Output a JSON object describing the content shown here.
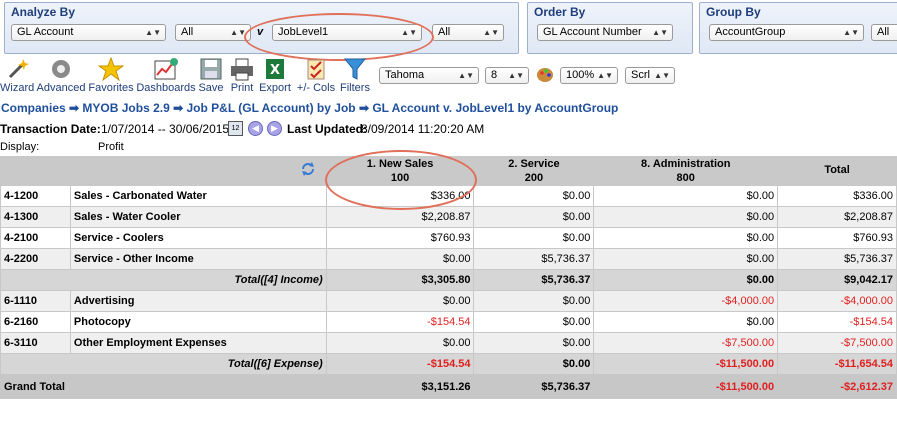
{
  "analyze_by": {
    "title": "Analyze By",
    "field1": "GL Account",
    "filter1": "All",
    "connector": "v",
    "field2": "JobLevel1",
    "filter2": "All"
  },
  "order_by": {
    "title": "Order By",
    "field": "GL Account Number"
  },
  "group_by": {
    "title": "Group By",
    "field": "AccountGroup",
    "filter": "All"
  },
  "toolbar": {
    "items": [
      "Wizard",
      "Advanced",
      "Favorites",
      "Dashboards",
      "Save",
      "Print",
      "Export",
      "+/- Cols",
      "Filters"
    ],
    "font": "Tahoma",
    "font_size": "8",
    "zoom": "100%",
    "scroll": "Scrl"
  },
  "breadcrumb": "Companies ➡ MYOB Jobs 2.9 ➡ Job P&L (GL Account) by Job ➡ GL Account v. JobLevel1 by AccountGroup",
  "info": {
    "transaction_label": "Transaction Date:",
    "transaction_value": "1/07/2014 -- 30/06/2015",
    "calendar_text": "12",
    "updated_label": "Last Updated:",
    "updated_value": "8/09/2014 11:20:20 AM",
    "display_label": "Display:",
    "display_value": "Profit"
  },
  "columns": [
    {
      "line1": "1. New Sales",
      "line2": "100"
    },
    {
      "line1": "2. Service",
      "line2": "200"
    },
    {
      "line1": "8. Administration",
      "line2": "800"
    },
    {
      "line1": "Total",
      "line2": ""
    }
  ],
  "rows": [
    {
      "code": "4-1200",
      "name": "Sales - Carbonated Water",
      "v": [
        "$336.00",
        "$0.00",
        "$0.00",
        "$336.00"
      ]
    },
    {
      "code": "4-1300",
      "name": "Sales - Water Cooler",
      "v": [
        "$2,208.87",
        "$0.00",
        "$0.00",
        "$2,208.87"
      ]
    },
    {
      "code": "4-2100",
      "name": "Service - Coolers",
      "v": [
        "$760.93",
        "$0.00",
        "$0.00",
        "$760.93"
      ]
    },
    {
      "code": "4-2200",
      "name": "Service - Other Income",
      "v": [
        "$0.00",
        "$5,736.37",
        "$0.00",
        "$5,736.37"
      ]
    },
    {
      "total": "Total([4] Income)",
      "v": [
        "$3,305.80",
        "$5,736.37",
        "$0.00",
        "$9,042.17"
      ]
    },
    {
      "code": "6-1110",
      "name": "Advertising",
      "v": [
        "$0.00",
        "$0.00",
        "-$4,000.00",
        "-$4,000.00"
      ]
    },
    {
      "code": "6-2160",
      "name": "Photocopy",
      "v": [
        "-$154.54",
        "$0.00",
        "$0.00",
        "-$154.54"
      ]
    },
    {
      "code": "6-3110",
      "name": "Other Employment Expenses",
      "v": [
        "$0.00",
        "$0.00",
        "-$7,500.00",
        "-$7,500.00"
      ]
    },
    {
      "total": "Total([6] Expense)",
      "v": [
        "-$154.54",
        "$0.00",
        "-$11,500.00",
        "-$11,654.54"
      ]
    },
    {
      "grand": "Grand Total",
      "v": [
        "$3,151.26",
        "$5,736.37",
        "-$11,500.00",
        "-$2,612.37"
      ]
    }
  ],
  "colors": {
    "negative": "#e02020",
    "annotation": "#e0705a",
    "link": "#1f4f9c"
  }
}
